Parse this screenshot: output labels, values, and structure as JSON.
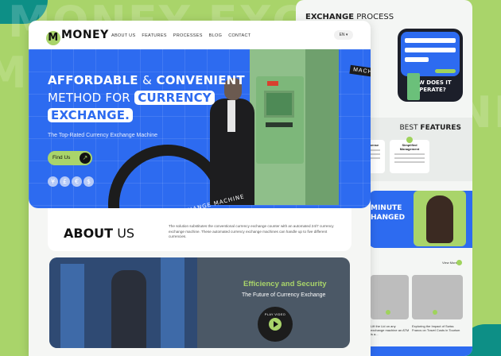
{
  "background": {
    "word": "MONEY EXC"
  },
  "front": {
    "logo": "MONEY",
    "nav": [
      "ABOUT US",
      "FEATURES",
      "PROCESSES",
      "BLOG",
      "CONTACT"
    ],
    "lang": "EN",
    "hero": {
      "line1_a": "AFFORDABLE",
      "line1_b": "&",
      "line1_c": "CONVENIENT",
      "line2_a": "METHOD FOR",
      "line2_b": "CURRENCY",
      "line3": "EXCHANGE.",
      "subtitle": "The Top-Rated Currency Exchange Machine",
      "cta": "Find Us",
      "currencies": [
        "¥",
        "£",
        "€",
        "$"
      ],
      "arc_text": "MONEY EXCHANGE MACHINE",
      "side_tag": "MACH"
    },
    "about": {
      "title_bold": "ABOUT",
      "title_thin": "US",
      "description": "The solution substitutes the conventional currency exchange counter with an automated 24/7 currency exchange machine. These automated currency exchange machines can handle up to five different currencies."
    },
    "feature_card": {
      "title": "Efficiency and Security",
      "subtitle": "The Future of Currency Exchange",
      "badge_text": "PLAY VIDEO"
    }
  },
  "back": {
    "exchange_title_bold": "EXCHANGE",
    "exchange_title_thin": "PROCESS",
    "phone_question": "HOW DOES IT OPERATE?",
    "best_thin": "BEST",
    "best_bold": "FEATURES",
    "features": [
      "Reduced Expense",
      "Simplified Management"
    ],
    "banner_line1": "MINUTE",
    "banner_line2": "HANGED",
    "view_more": "View More",
    "captions": [
      "Lift the Lid on any exchange machine an ATM is a...",
      "Exploring the Impact of Swiss Francs on Travel Costs in Tourism"
    ]
  },
  "colors": {
    "brand_blue": "#2d6bf0",
    "lime": "#a9d46a",
    "teal": "#0d8f86",
    "dark": "#1c1c1c"
  }
}
